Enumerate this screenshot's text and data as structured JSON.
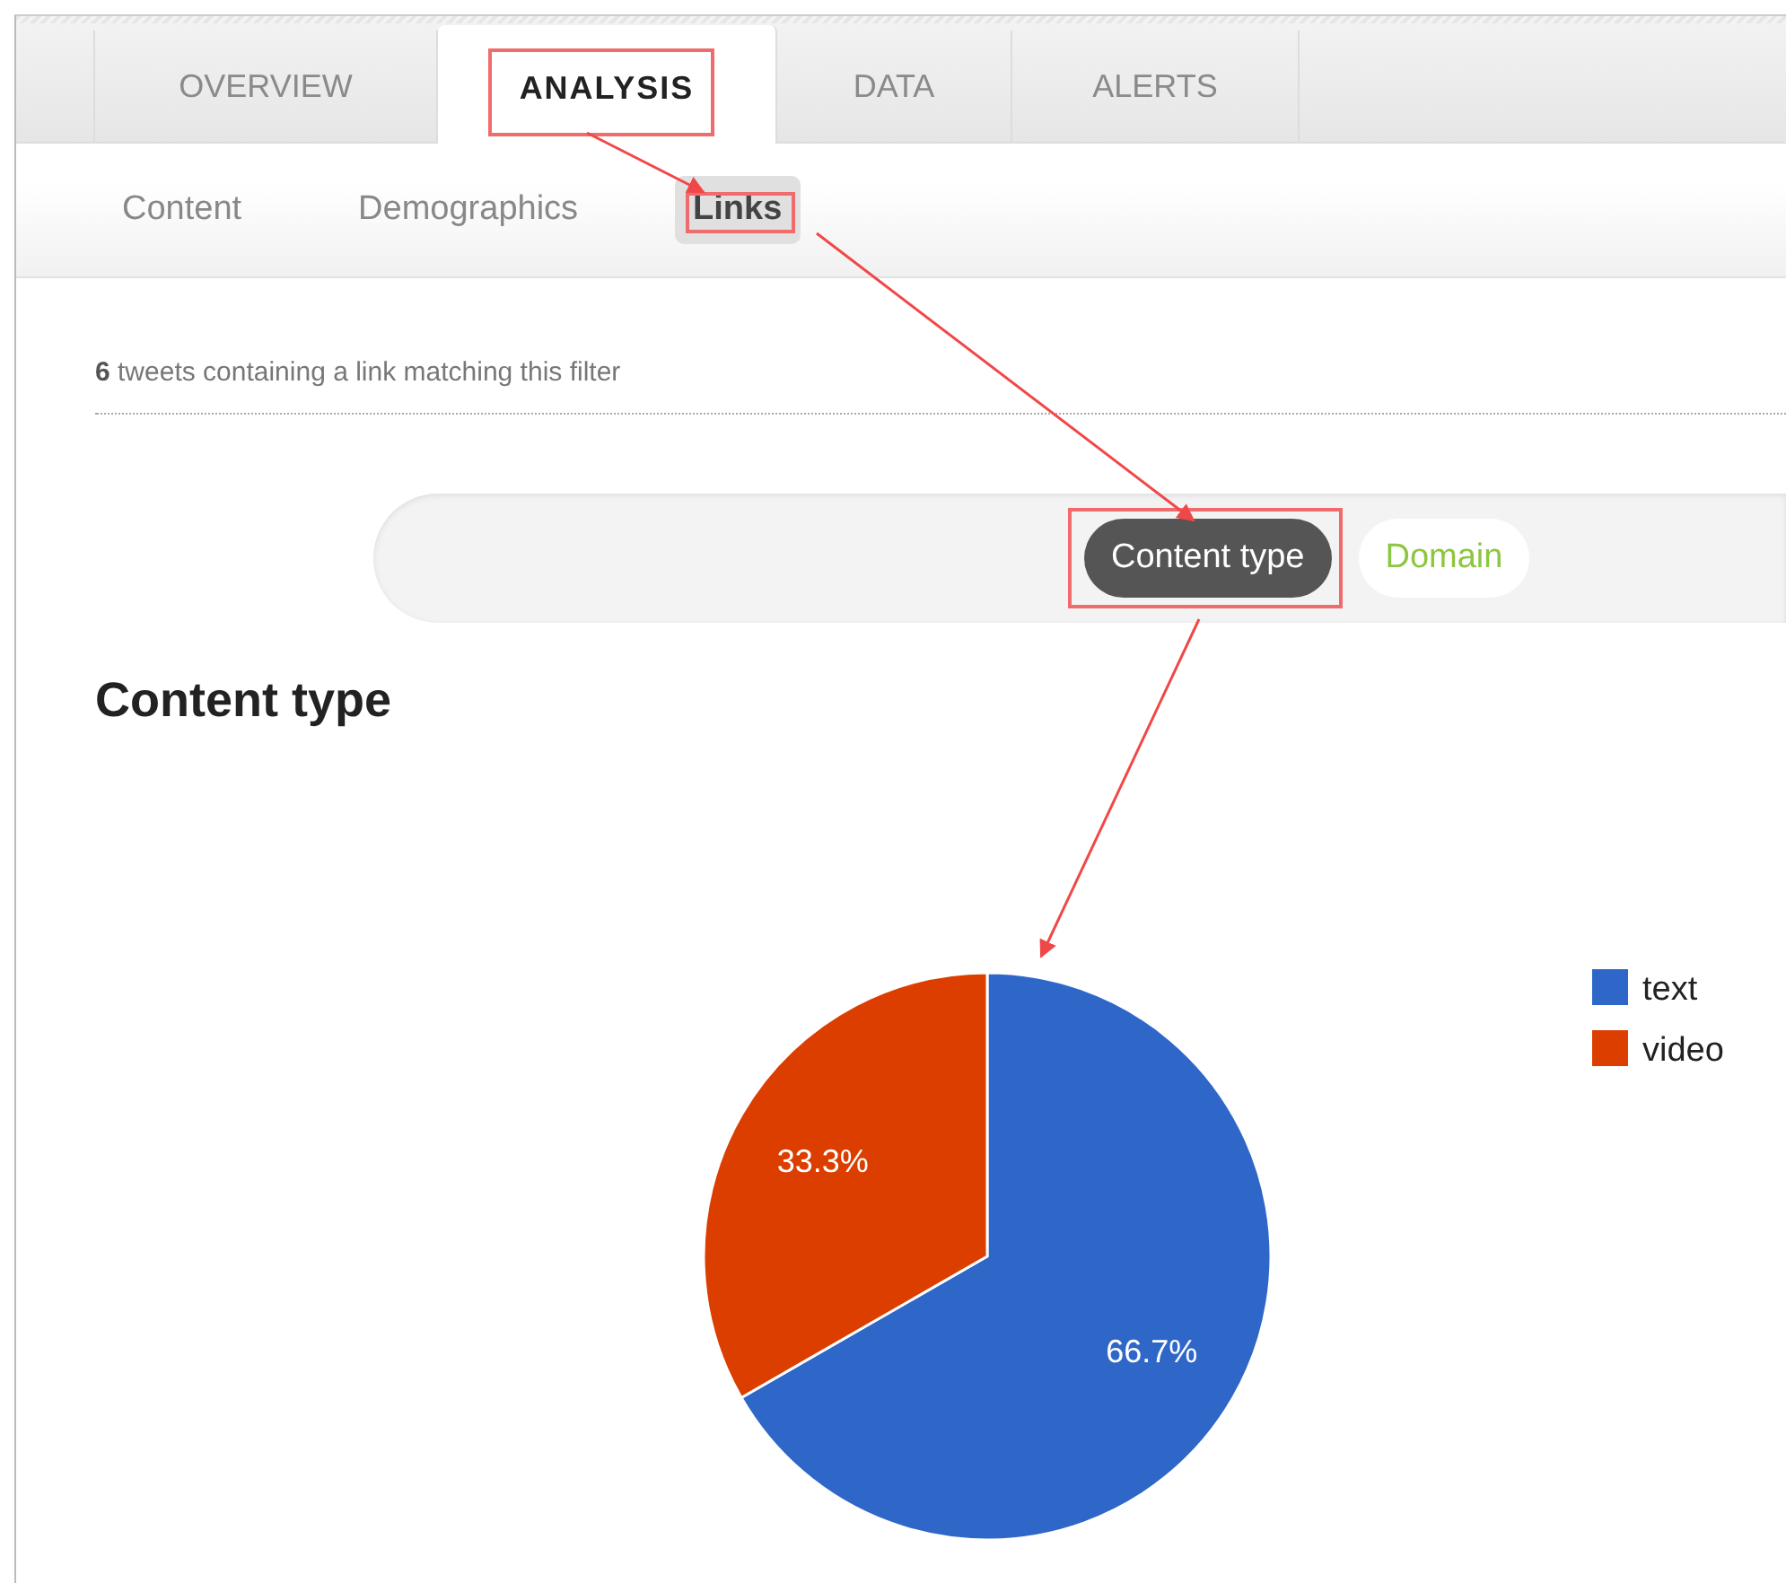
{
  "tabs": [
    {
      "label": "OVERVIEW",
      "selected": false,
      "highlighted": false
    },
    {
      "label": "ANALYSIS",
      "selected": true,
      "highlighted": true
    },
    {
      "label": "DATA",
      "selected": false,
      "highlighted": false
    },
    {
      "label": "ALERTS",
      "selected": false,
      "highlighted": false
    }
  ],
  "subtabs": [
    {
      "label": "Content",
      "selected": false,
      "highlighted": false
    },
    {
      "label": "Demographics",
      "selected": false,
      "highlighted": false
    },
    {
      "label": "Links",
      "selected": true,
      "highlighted": true
    }
  ],
  "summary": {
    "count": "6",
    "text": "tweets containing a link matching this filter"
  },
  "filters": [
    {
      "label": "Content type",
      "selected": true,
      "highlighted": true
    },
    {
      "label": "Domain",
      "selected": false,
      "highlighted": false
    }
  ],
  "section_title": "Content type",
  "chart_data": {
    "type": "pie",
    "categories": [
      "text",
      "video"
    ],
    "values": [
      66.7,
      33.3
    ],
    "colors": [
      "#2f67c8",
      "#dc3e00"
    ],
    "legend": "right",
    "value_labels": [
      "66.7%",
      "33.3%"
    ]
  }
}
